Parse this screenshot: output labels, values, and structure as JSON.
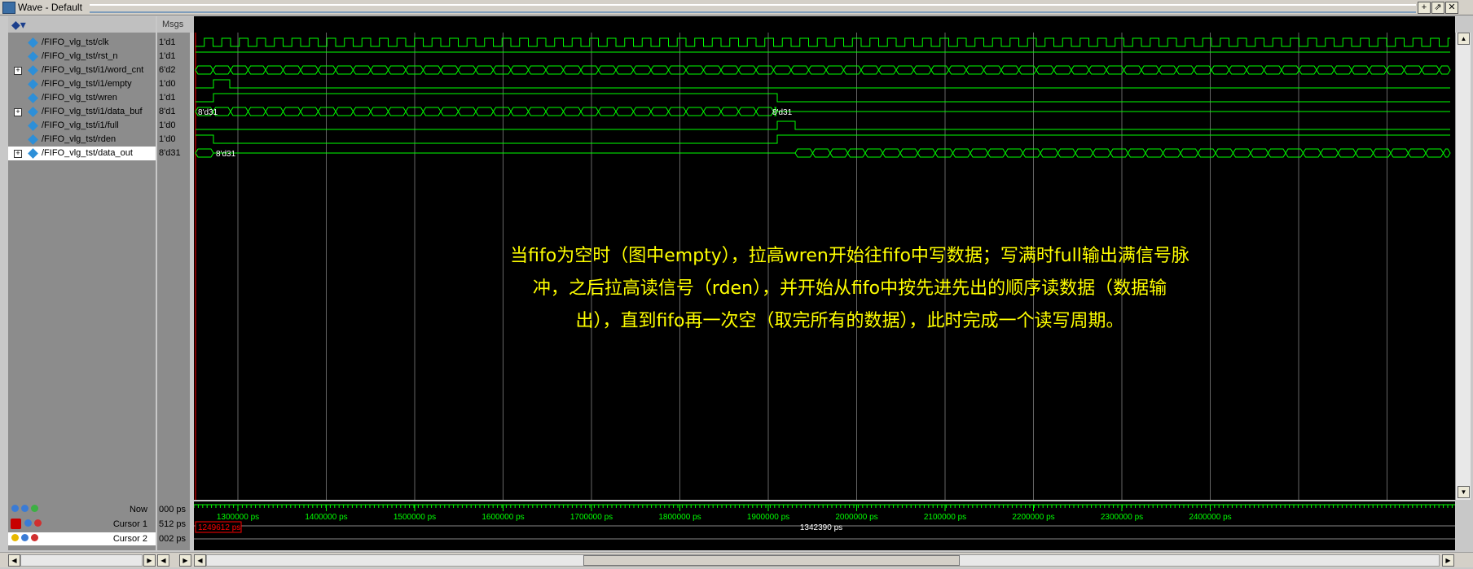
{
  "window": {
    "title": "Wave - Default",
    "buttons": [
      "+",
      "⇗",
      "✕"
    ]
  },
  "columns": {
    "msgs": "Msgs"
  },
  "signals": [
    {
      "name": "/FIFO_vlg_tst/clk",
      "value": "1'd1",
      "expandable": false
    },
    {
      "name": "/FIFO_vlg_tst/rst_n",
      "value": "1'd1",
      "expandable": false
    },
    {
      "name": "/FIFO_vlg_tst/i1/word_cnt",
      "value": "6'd2",
      "expandable": true
    },
    {
      "name": "/FIFO_vlg_tst/i1/empty",
      "value": "1'd0",
      "expandable": false
    },
    {
      "name": "/FIFO_vlg_tst/wren",
      "value": "1'd1",
      "expandable": false
    },
    {
      "name": "/FIFO_vlg_tst/i1/data_buf",
      "value": "8'd1",
      "expandable": true
    },
    {
      "name": "/FIFO_vlg_tst/i1/full",
      "value": "1'd0",
      "expandable": false
    },
    {
      "name": "/FIFO_vlg_tst/rden",
      "value": "1'd0",
      "expandable": false
    },
    {
      "name": "/FIFO_vlg_tst/data_out",
      "value": "8'd31",
      "expandable": true
    }
  ],
  "bus_labels": {
    "data_buf_start": "8'd31",
    "data_buf_mid": "8'd31",
    "data_out_start": "8'd31"
  },
  "annotation": {
    "line1": "当fifo为空时（图中empty），拉高wren开始往fifo中写数据；写满时full输出满信号脉",
    "line2": "冲，之后拉高读信号（rden），并开始从fifo中按先进先出的顺序读数据（数据输",
    "line3": "出），直到fifo再一次空（取完所有的数据），此时完成一个读写周期。"
  },
  "bottom": {
    "now_label": "Now",
    "now_value": "000 ps",
    "cursor1_label": "Cursor 1",
    "cursor1_value": "512 ps",
    "cursor2_label": "Cursor 2",
    "cursor2_value": "002 ps",
    "cursor1_marker": "1249612 ps",
    "cursor_delta": "1342390 ps"
  },
  "timeline_ticks": [
    "1300000 ps",
    "1400000 ps",
    "1500000 ps",
    "1600000 ps",
    "1700000 ps",
    "1800000 ps",
    "1900000 ps",
    "2000000 ps",
    "2100000 ps",
    "2200000 ps",
    "2300000 ps",
    "2400000 ps"
  ],
  "colors": {
    "wave": "#00ff00",
    "cursor": "#ff0000",
    "annotation": "#ffff00",
    "grid": "#666666"
  }
}
